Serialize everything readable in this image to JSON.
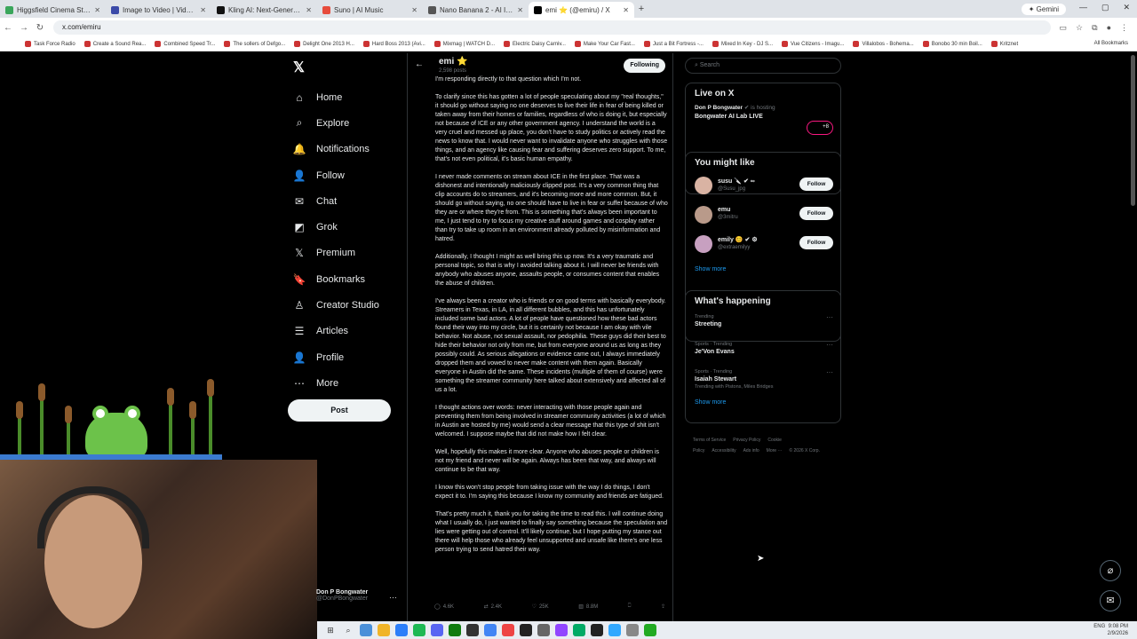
{
  "browser": {
    "tabs": [
      {
        "title": "Higgsfield Cinema Studio | Pro",
        "color": "#3aa65b"
      },
      {
        "title": "Image to Video | Vidu AI",
        "color": "#3b4aa8"
      },
      {
        "title": "Kling AI: Next-Generation AI Cr",
        "color": "#111111"
      },
      {
        "title": "Suno | AI Music",
        "color": "#e74c3c"
      },
      {
        "title": "Nano Banana 2 - AI Image Gen",
        "color": "#555555"
      },
      {
        "title": "emi ⭐ (@emiru) / X",
        "color": "#000000"
      }
    ],
    "active_tab": 5,
    "new_tab": "+",
    "gemini": "✦ Gemini",
    "url": "x.com/emiru",
    "bookmarks": [
      "Task Force Radio",
      "Create a Sound Rea...",
      "Combined Speed Tr...",
      "The sollers of Defgo...",
      "Delight One 2013 H...",
      "Hard Boss 2013 (Avi...",
      "Mixmag | WATCH D...",
      "Electric Daisy Carniv...",
      "Make Your Car Fast...",
      "Just a Bit Fortress -...",
      "Mixed In Key - DJ S...",
      "Vue Citizens - Imagu...",
      "Villalobos - Bohema...",
      "Bonobo 30 min Boil...",
      "Kritznet"
    ],
    "all_bookmarks": "All Bookmarks"
  },
  "nav": {
    "logo": "𝕏",
    "items": [
      {
        "label": "Home",
        "icon": "⌂",
        "name": "home"
      },
      {
        "label": "Explore",
        "icon": "⌕",
        "name": "explore"
      },
      {
        "label": "Notifications",
        "icon": "🔔",
        "name": "notifications"
      },
      {
        "label": "Follow",
        "icon": "👤",
        "name": "follow"
      },
      {
        "label": "Chat",
        "icon": "✉",
        "name": "chat"
      },
      {
        "label": "Grok",
        "icon": "◩",
        "name": "grok"
      },
      {
        "label": "Premium",
        "icon": "𝕏",
        "name": "premium"
      },
      {
        "label": "Bookmarks",
        "icon": "🔖",
        "name": "bookmarks"
      },
      {
        "label": "Creator Studio",
        "icon": "♙",
        "name": "creator-studio"
      },
      {
        "label": "Articles",
        "icon": "☰",
        "name": "articles"
      },
      {
        "label": "Profile",
        "icon": "👤",
        "name": "profile"
      },
      {
        "label": "More",
        "icon": "⋯",
        "name": "more"
      }
    ],
    "post": "Post",
    "account_name": "Don P Bongwater",
    "account_handle": "@DonPBongwater",
    "account_more": "···"
  },
  "header": {
    "name": "emi ⭐",
    "count": "2,598 posts",
    "follow": "Following"
  },
  "post": {
    "paragraphs": [
      "I'm responding directly to that question which I'm not.",
      "To clarify since this has gotten a lot of people speculating about my \"real thoughts,\" it should go without saying no one deserves to live their life in fear of being killed or taken away from their homes or families, regardless of who is doing it, but especially not because of ICE or any other government agency. I understand the world is a very cruel and messed up place, you don't have to study politics or actively read the news to know that. I would never want to invalidate anyone who struggles with those things, and an agency like causing fear and suffering deserves zero support. To me, that's not even political, it's basic human empathy.",
      "I never made comments on stream about ICE in the first place. That was a dishonest and intentionally maliciously clipped post. It's a very common thing that clip accounts do to streamers, and it's becoming more and more common. But, it should go without saying, no one should have to live in fear or suffer because of who they are or where they're from. This is something that's always been important to me, I just tend to try to focus my creative stuff around games and cosplay rather than try to take up room in an environment already polluted by misinformation and hatred.",
      "Additionally, I thought I might as well bring this up now. It's a very traumatic and personal topic, so that is why I avoided talking about it. I will never be friends with anybody who abuses anyone, assaults people, or consumes content that enables the abuse of children.",
      "I've always been a creator who is friends or on good terms with basically everybody. Streamers in Texas, in LA, in all different bubbles, and this has unfortunately included some bad actors. A lot of people have questioned how these bad actors found their way into my circle, but it is certainly not because I am okay with vile behavior. Not abuse, not sexual assault, nor pedophilia. These guys did their best to hide their behavior not only from me, but from everyone around us as long as they possibly could. As serious allegations or evidence came out, I always immediately dropped them and vowed to never make content with them again. Basically everyone in Austin did the same. These incidents (multiple of them of course) were something the streamer community here talked about extensively and affected all of us a lot.",
      "I thought actions over words: never interacting with those people again and preventing them from being involved in streamer community activities (a lot of which in Austin are hosted by me) would send a clear message that this type of shit isn't welcomed. I suppose maybe that did not make how I felt clear.",
      "Well, hopefully this makes it more clear. Anyone who abuses people or children is not my friend and never will be again. Always has been that way, and always will continue to be that way.",
      "I know this won't stop people from taking issue with the way I do things, I don't expect it to. I'm saying this because I know my community and friends are fatigued.",
      "That's pretty much it, thank you for taking the time to read this. I will continue doing what I usually do, I just wanted to finally say something because the speculation and lies were getting out of control. It'll likely continue, but I hope putting my stance out there will help those who already feel unsupported and unsafe like there's one less person trying to send hatred their way."
    ],
    "actions": {
      "replies": "4.6K",
      "reposts": "2.4K",
      "likes": "25K",
      "views": "8.8M"
    }
  },
  "right": {
    "search": "Search",
    "live_title": "Live on X",
    "live_host": "Don P Bongwater",
    "live_host_suffix": "is hosting",
    "live_name": "Bongwater AI Lab LIVE",
    "live_badge": "+8",
    "you_might_like": "You might like",
    "suggestions": [
      {
        "name": "susu 🔪 ✔ ∞",
        "handle": "@Susu_jpg",
        "follow": "Follow"
      },
      {
        "name": "emu",
        "handle": "@3mitru",
        "follow": "Follow"
      },
      {
        "name": "emily 😊 ✔ ⚙",
        "handle": "@extraemilyy",
        "follow": "Follow"
      }
    ],
    "show_more": "Show more",
    "happening": "What's happening",
    "trends": [
      {
        "context": "Trending",
        "name": "Streeting",
        "sub": ""
      },
      {
        "context": "Sports · Trending",
        "name": "Je'Von Evans",
        "sub": ""
      },
      {
        "context": "Sports · Trending",
        "name": "Isaiah Stewart",
        "sub": "Trending with Pistons, Miles Bridges"
      }
    ],
    "show_more_2": "Show more",
    "footer": [
      "Terms of Service",
      "Privacy Policy",
      "Cookie Policy",
      "Accessibility",
      "Ads info",
      "More ···",
      "© 2026 X Corp."
    ]
  },
  "tray": {
    "lang": "ENG",
    "time": "9:08 PM",
    "date": "2/9/2026"
  }
}
